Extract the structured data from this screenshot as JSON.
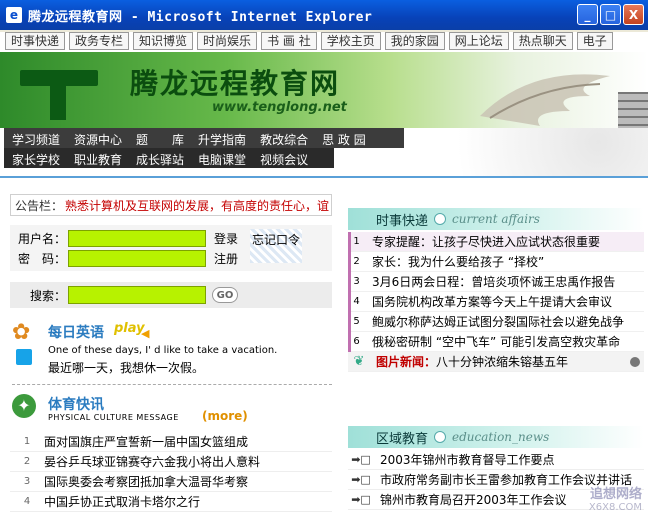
{
  "window": {
    "title": "腾龙远程教育网 - Microsoft Internet Explorer",
    "icon": "ie-icon",
    "buttons": {
      "minimize": "_",
      "maximize": "□",
      "close": "X"
    }
  },
  "topnav": {
    "links": [
      "时事快递",
      "政务专栏",
      "知识博览",
      "时尚娱乐",
      "书 画 社",
      "学校主页",
      "我的家园",
      "网上论坛",
      "热点聊天",
      "电子"
    ]
  },
  "banner": {
    "title": "腾龙远程教育网",
    "url": "www.tenglong.net",
    "nav_row1": [
      "学习频道",
      "资源中心",
      "题　　库",
      "升学指南",
      "教改综合",
      "思 政 园"
    ],
    "nav_row2": [
      "家长学校",
      "职业教育",
      "成长驿站",
      "电脑课堂",
      "视频会议"
    ]
  },
  "notice": {
    "label": "公告栏：",
    "text": "熟悉计算机及互联网的发展，有高度的责任心，谊"
  },
  "login": {
    "username_label": "用户名：",
    "password_label": "密　码：",
    "login_button": "登录",
    "register_button": "注册",
    "forgot_link": "忘记口令"
  },
  "search": {
    "label": "搜索：",
    "go_label": "GO"
  },
  "english": {
    "title": "每日英语",
    "play_label": "play",
    "english_text": "One of these days, I' d like to take a vacation.",
    "chinese_text": "最近哪一天，我想休一次假。"
  },
  "sports": {
    "title": "体育快讯",
    "subtitle": "PHYSICAL CULTURE MESSAGE",
    "more_label": "(more)",
    "items": [
      {
        "num": "1",
        "text": "面对国旗庄严宣誓新一届中国女篮组成"
      },
      {
        "num": "2",
        "text": "晏谷乒乓球亚锦赛夺六金我小将出人意料"
      },
      {
        "num": "3",
        "text": "国际奥委会考察团抵加拿大温哥华考察"
      },
      {
        "num": "4",
        "text": "中国乒协正式取消卡塔尔之行"
      }
    ]
  },
  "current_affairs": {
    "title_cn": "时事快递",
    "title_en": "current affairs",
    "items": [
      {
        "num": "1",
        "text": "专家提醒：让孩子尽快进入应试状态很重要"
      },
      {
        "num": "2",
        "text": "家长：我为什么要给孩子 “择校”"
      },
      {
        "num": "3",
        "text": "3月6日两会日程：曾培炎项怀诚王忠禹作报告"
      },
      {
        "num": "4",
        "text": "国务院机构改革方案等今天上午提请大会审议"
      },
      {
        "num": "5",
        "text": "鲍威尔称萨达姆正试图分裂国际社会以避免战争"
      },
      {
        "num": "6",
        "text": "俄秘密研制 “空中飞车” 可能引发高空救灾革命"
      }
    ],
    "picture_news": {
      "label": "图片新闻：",
      "text": "八十分钟浓缩朱镕基五年"
    }
  },
  "regional": {
    "title_cn": "区域教育",
    "title_en": "education_news",
    "items": [
      {
        "arrow": "➡□",
        "text": "2003年锦州市教育督导工作要点"
      },
      {
        "arrow": "➡□",
        "text": "市政府常务副市长王雷参加教育工作会议并讲话"
      },
      {
        "arrow": "➡□",
        "text": "锦州市教育局召开2003年工作会议"
      }
    ]
  },
  "watermark": {
    "line1": "追想网络",
    "line2": "X6X8.COM"
  }
}
